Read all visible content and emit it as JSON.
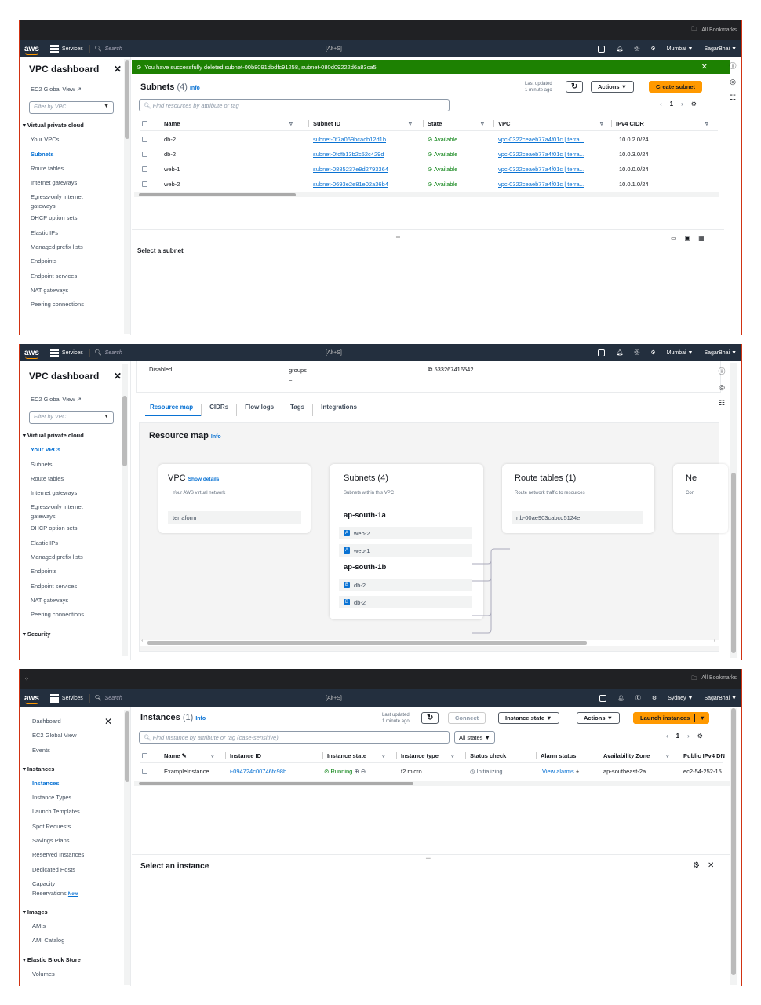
{
  "common": {
    "services": "Services",
    "search_placeholder": "Search",
    "shortcut": "[Alt+S]",
    "all_bookmarks": "All Bookmarks",
    "aws_logo": "aws"
  },
  "panel1": {
    "region": "Mumbai ▼",
    "user": "SagarBhai ▼",
    "sidebar": {
      "title": "VPC dashboard",
      "global_view": "EC2 Global View",
      "filter": "Filter by VPC",
      "section": "Virtual private cloud",
      "items": [
        "Your VPCs",
        "Subnets",
        "Route tables",
        "Internet gateways",
        "Egress-only internet",
        "gateways",
        "DHCP option sets",
        "Elastic IPs",
        "Managed prefix lists",
        "Endpoints",
        "Endpoint services",
        "NAT gateways",
        "Peering connections"
      ]
    },
    "flash": "You have successfully deleted subnet-00b8091dbdfc91258, subnet-080d09222d6a83ca5",
    "heading": "Subnets",
    "count": "(4)",
    "info": "Info",
    "last_updated": "Last updated",
    "last_updated_time": "1 minute ago",
    "actions": "Actions ▼",
    "create": "Create subnet",
    "find_placeholder": "Find resources by attribute or tag",
    "page": "1",
    "columns": [
      "Name",
      "Subnet ID",
      "State",
      "VPC",
      "IPv4 CIDR"
    ],
    "rows": [
      {
        "name": "db-2",
        "id": "subnet-0f7a069bcacb12d1b",
        "state": "Available",
        "vpc": "vpc-0322ceaeb77a4f01c | terra...",
        "cidr": "10.0.2.0/24"
      },
      {
        "name": "db-2",
        "id": "subnet-0fcfb13b2c52c429d",
        "state": "Available",
        "vpc": "vpc-0322ceaeb77a4f01c | terra...",
        "cidr": "10.0.3.0/24"
      },
      {
        "name": "web-1",
        "id": "subnet-0885237e9d2793364",
        "state": "Available",
        "vpc": "vpc-0322ceaeb77a4f01c | terra...",
        "cidr": "10.0.0.0/24"
      },
      {
        "name": "web-2",
        "id": "subnet-0693e2e81e02a36b4",
        "state": "Available",
        "vpc": "vpc-0322ceaeb77a4f01c | terra...",
        "cidr": "10.0.1.0/24"
      }
    ],
    "select_msg": "Select a subnet"
  },
  "panel2": {
    "region": "Mumbai ▼",
    "user": "SagarBhai ▼",
    "sidebar": {
      "title": "VPC dashboard",
      "global_view": "EC2 Global View",
      "filter": "Filter by VPC",
      "section": "Virtual private cloud",
      "items": [
        "Your VPCs",
        "Subnets",
        "Route tables",
        "Internet gateways",
        "Egress-only internet",
        "gateways",
        "DHCP option sets",
        "Elastic IPs",
        "Managed prefix lists",
        "Endpoints",
        "Endpoint services",
        "NAT gateways",
        "Peering connections"
      ],
      "security": "Security"
    },
    "top_disabled": "Disabled",
    "top_groups": "groups",
    "top_dash": "–",
    "account": "533267416542",
    "tabs": [
      "Resource map",
      "CIDRs",
      "Flow logs",
      "Tags",
      "Integrations"
    ],
    "map_title": "Resource map",
    "info": "Info",
    "vpc_card": {
      "title": "VPC",
      "link": "Show details",
      "sub": "Your AWS virtual network",
      "value": "terraform"
    },
    "subnets_card": {
      "title": "Subnets (4)",
      "sub": "Subnets within this VPC",
      "az1": "ap-south-1a",
      "az2": "ap-south-1b",
      "a_items": [
        "web-2",
        "web-1"
      ],
      "b_items": [
        "db-2",
        "db-2"
      ],
      "badge_a": "A",
      "badge_b": "B"
    },
    "routes_card": {
      "title": "Route tables (1)",
      "sub": "Route network traffic to resources",
      "value": "rtb-00ae903cabcd5124e"
    },
    "net_card": {
      "title": "Ne",
      "sub": "Con"
    }
  },
  "panel3": {
    "region": "Sydney ▼",
    "user": "SagarBhai ▼",
    "sidebar": {
      "items_top": [
        "Dashboard",
        "EC2 Global View",
        "Events"
      ],
      "instances_section": "Instances",
      "instances_items": [
        "Instances",
        "Instance Types",
        "Launch Templates",
        "Spot Requests",
        "Savings Plans",
        "Reserved Instances",
        "Dedicated Hosts",
        "Capacity",
        "Reservations"
      ],
      "new_badge": "New",
      "images_section": "Images",
      "images_items": [
        "AMIs",
        "AMI Catalog"
      ],
      "ebs_section": "Elastic Block Store",
      "ebs_items": [
        "Volumes"
      ]
    },
    "heading": "Instances",
    "count": "(1)",
    "info": "Info",
    "last_updated": "Last updated",
    "last_updated_time": "1 minute ago",
    "connect": "Connect",
    "instance_state": "Instance state ▼",
    "actions": "Actions ▼",
    "launch": "Launch instances",
    "find_placeholder": "Find Instance by attribute or tag (case-sensitive)",
    "all_states": "All states ▼",
    "page": "1",
    "columns": [
      "Name",
      "Instance ID",
      "Instance state",
      "Instance type",
      "Status check",
      "Alarm status",
      "Availability Zone",
      "Public IPv4 DN"
    ],
    "row": {
      "name": "ExampleInstance",
      "id": "i-094724c00746fc98b",
      "state": "Running",
      "type": "t2.micro",
      "status": "Initializing",
      "alarm": "View alarms",
      "az": "ap-southeast-2a",
      "dns": "ec2-54-252-15"
    },
    "select_msg": "Select an instance"
  }
}
